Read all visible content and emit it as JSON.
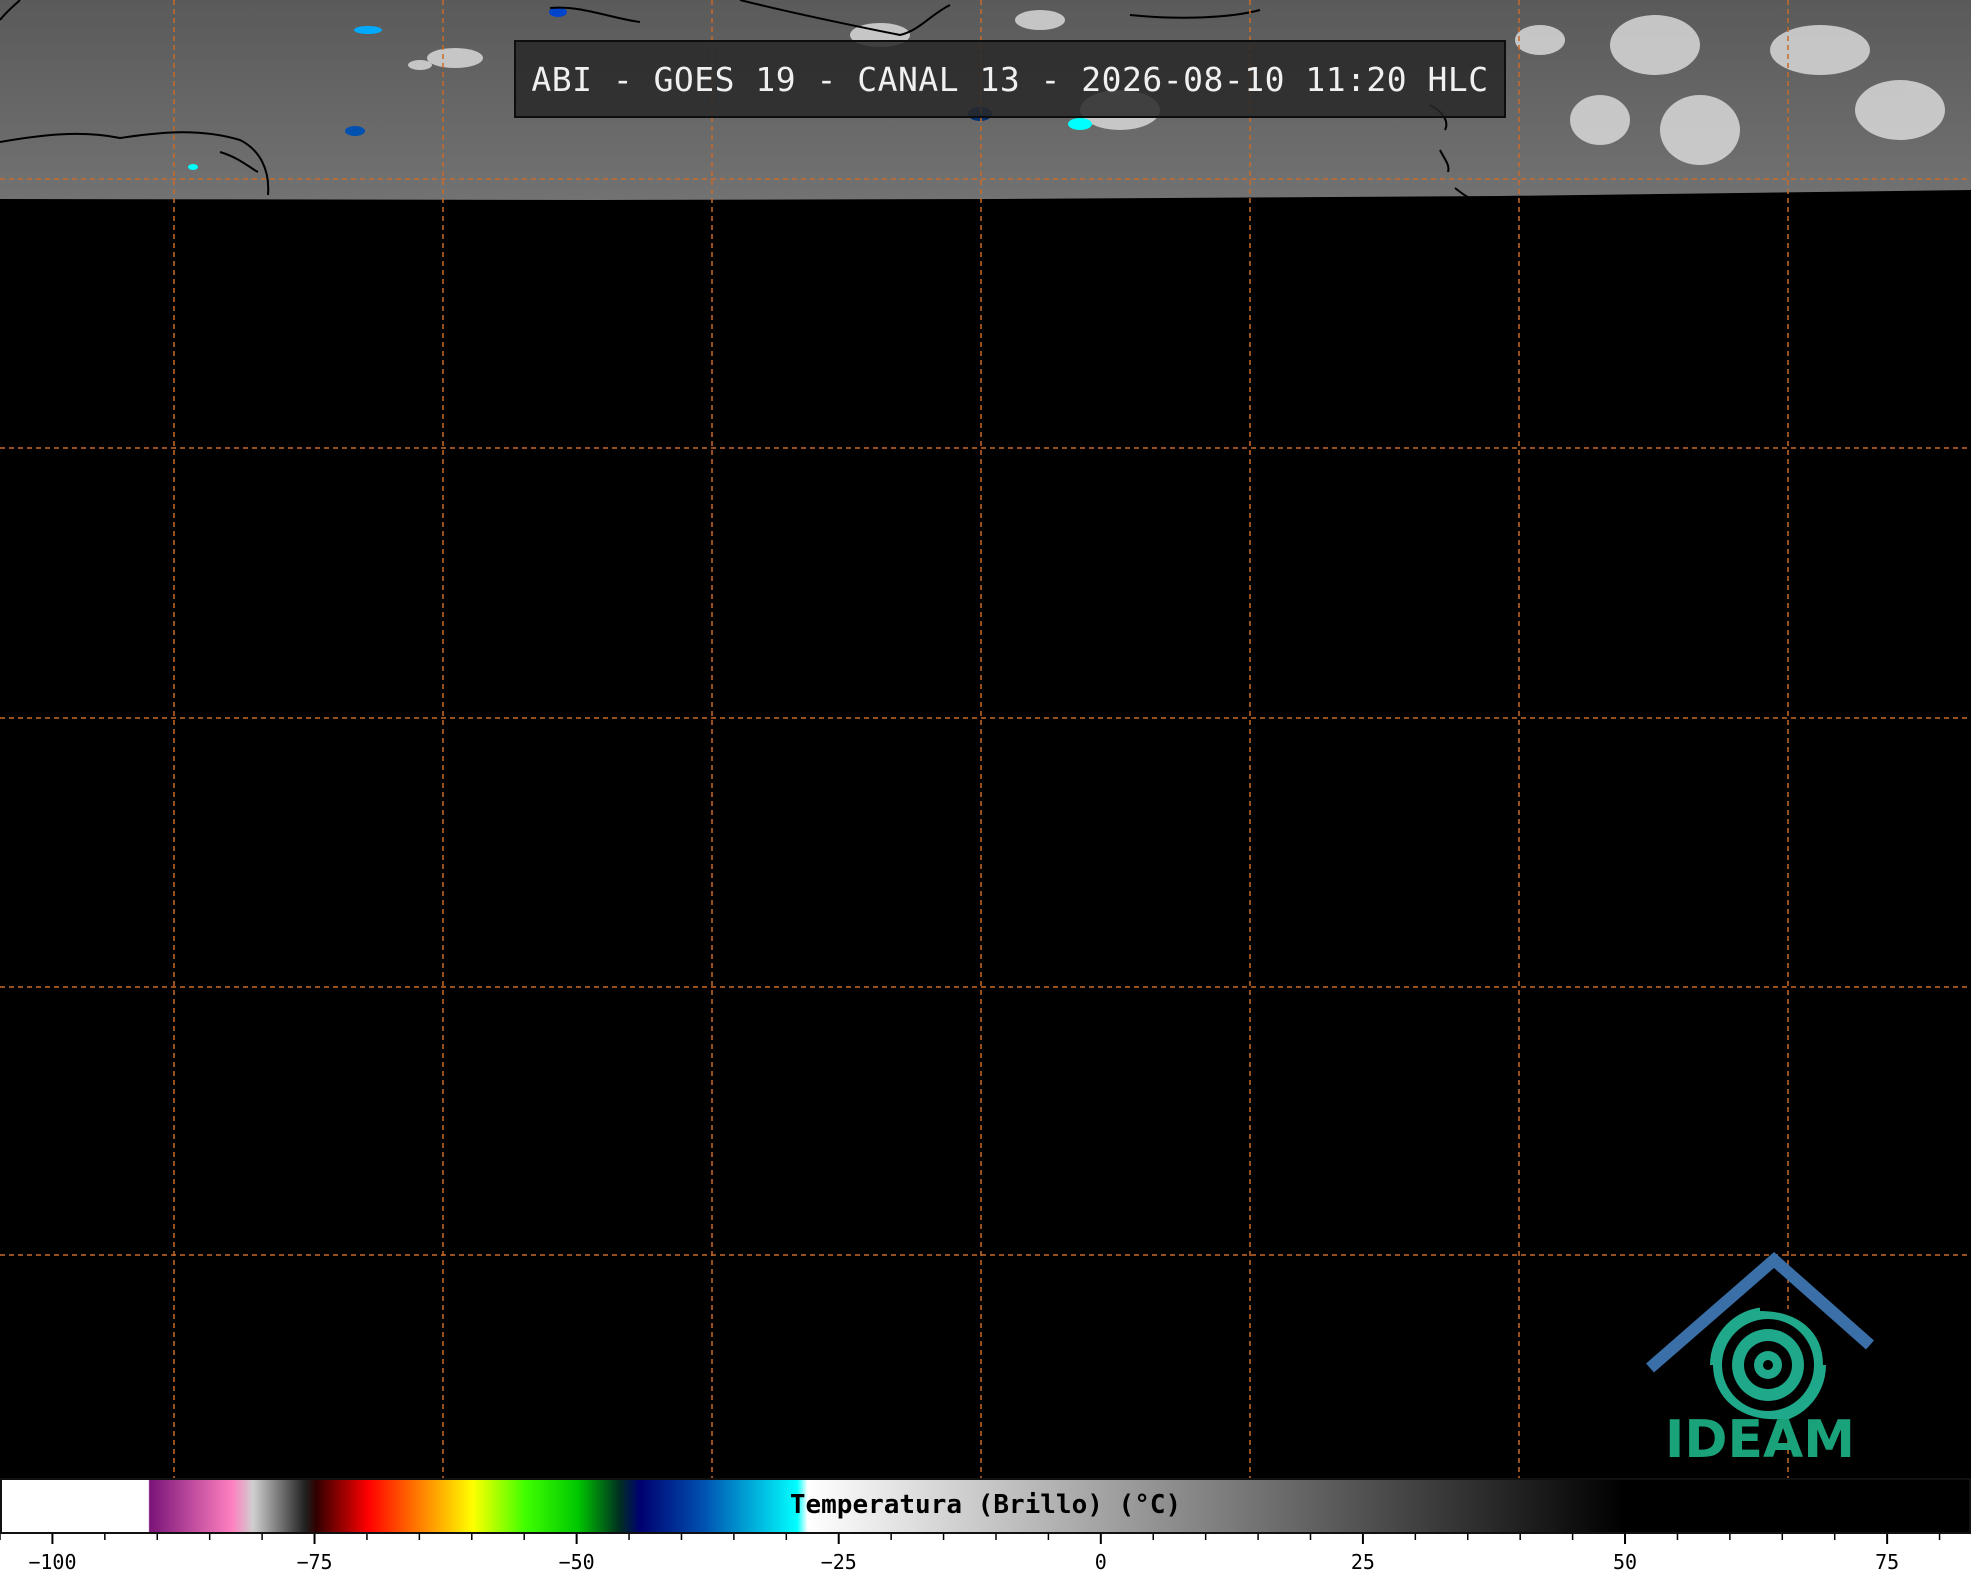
{
  "header": {
    "title": "ABI - GOES 19 - CANAL 13 - 2026-08-10 11:20 HLC"
  },
  "map": {
    "background_color": "#000000",
    "imagery_band_color": "#6b6b6b",
    "grid_color": "#c86a2a",
    "coastline_color": "#000000"
  },
  "colorbar": {
    "label": "Temperatura (Brillo) (°C)",
    "range": [
      -105,
      83
    ],
    "ticks": [
      "-100",
      "-75",
      "-50",
      "-25",
      "0",
      "25",
      "50",
      "75"
    ],
    "tick_values": [
      -100,
      -75,
      -50,
      -25,
      0,
      25,
      50,
      75
    ],
    "stops": [
      {
        "value": -105,
        "color": "#ffffff"
      },
      {
        "value": -91,
        "color": "#ffffff"
      },
      {
        "value": -90.9,
        "color": "#7a1478"
      },
      {
        "value": -83,
        "color": "#ff80c0"
      },
      {
        "value": -81,
        "color": "#cfcfcf"
      },
      {
        "value": -76,
        "color": "#202020"
      },
      {
        "value": -75,
        "color": "#300000"
      },
      {
        "value": -70,
        "color": "#ff0000"
      },
      {
        "value": -65,
        "color": "#ff8000"
      },
      {
        "value": -60,
        "color": "#ffff00"
      },
      {
        "value": -55,
        "color": "#40ff00"
      },
      {
        "value": -50,
        "color": "#00c800"
      },
      {
        "value": -46,
        "color": "#003020"
      },
      {
        "value": -44,
        "color": "#000070"
      },
      {
        "value": -38,
        "color": "#0050b0"
      },
      {
        "value": -29,
        "color": "#00ffff"
      },
      {
        "value": -28,
        "color": "#ffffff"
      },
      {
        "value": 50,
        "color": "#000000"
      },
      {
        "value": 83,
        "color": "#000000"
      }
    ]
  },
  "logo": {
    "text": "IDEAM",
    "text_color": "#1aa37a",
    "roof_color": "#3a6fa8",
    "swirl_color": "#1fa88a"
  }
}
